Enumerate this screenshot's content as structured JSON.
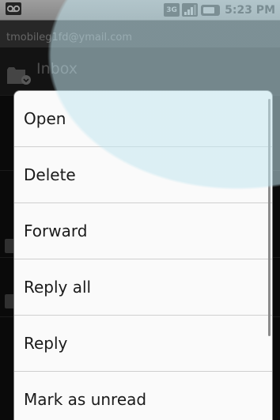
{
  "status_bar": {
    "time": "5:23 PM",
    "network": "3G",
    "icons": [
      "voicemail-icon",
      "3g-icon",
      "signal-icon",
      "battery-icon"
    ]
  },
  "account": {
    "email": "tmobileg1fd@ymail.com"
  },
  "folder": {
    "title": "Inbox",
    "icon": "folder-icon"
  },
  "context_menu": {
    "items": [
      {
        "label": "Open"
      },
      {
        "label": "Delete"
      },
      {
        "label": "Forward"
      },
      {
        "label": "Reply all"
      },
      {
        "label": "Reply"
      },
      {
        "label": "Mark as unread"
      }
    ]
  },
  "colors": {
    "menu_background": "#fafafa",
    "status_bar": "#dcdcdc",
    "account_bar": "#3c3c3c"
  }
}
